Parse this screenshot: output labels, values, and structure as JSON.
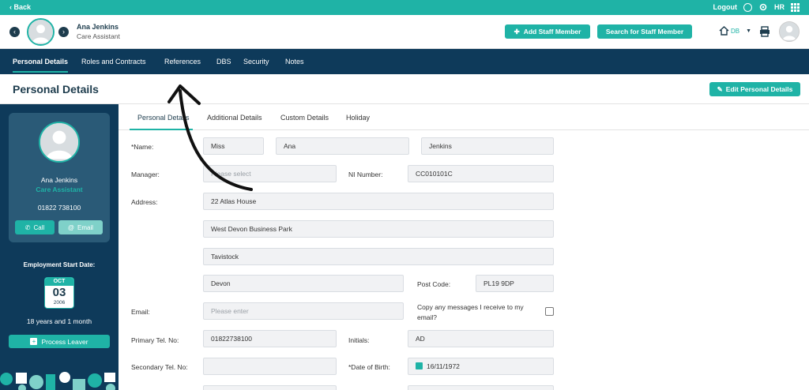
{
  "topbar": {
    "back": "‹ Back",
    "logout": "Logout",
    "hr": "HR"
  },
  "header": {
    "name": "Ana Jenkins",
    "role": "Care Assistant",
    "add_staff": "Add Staff Member",
    "search_staff": "Search for Staff Member",
    "location": "DB"
  },
  "nav": {
    "tabs": [
      "Personal Details",
      "Roles and Contracts",
      "References",
      "DBS",
      "Security",
      "Notes"
    ]
  },
  "title": {
    "text": "Personal Details",
    "edit_button": "Edit Personal Details"
  },
  "sidebar": {
    "name": "Ana Jenkins",
    "role": "Care Assistant",
    "phone": "01822 738100",
    "call": "Call",
    "email": "Email",
    "start_label": "Employment Start Date:",
    "start_month": "OCT",
    "start_day": "03",
    "start_year": "2006",
    "tenure": "18 years and 1 month",
    "process_leaver": "Process Leaver"
  },
  "subtabs": [
    "Personal Details",
    "Additional Details",
    "Custom Details",
    "Holiday"
  ],
  "form": {
    "name_label": "*Name:",
    "title": "Miss",
    "first_name": "Ana",
    "last_name": "Jenkins",
    "manager_label": "Manager:",
    "manager_placeholder": "Please select",
    "ni_label": "NI Number:",
    "ni_value": "CC010101C",
    "address_label": "Address:",
    "address1": "22 Atlas House",
    "address2": "West Devon Business Park",
    "address3": "Tavistock",
    "address4": "Devon",
    "postcode_label": "Post Code:",
    "postcode": "PL19 9DP",
    "email_label": "Email:",
    "email_placeholder": "Please enter",
    "copy_label_1": "Copy any messages I receive to my",
    "copy_label_2": "email?",
    "primary_label": "Primary Tel. No:",
    "primary_value": "01822738100",
    "initials_label": "Initials:",
    "initials_value": "AD",
    "secondary_label": "Secondary Tel. No:",
    "dob_label": "*Date of Birth:",
    "dob_value": "16/11/1972"
  }
}
